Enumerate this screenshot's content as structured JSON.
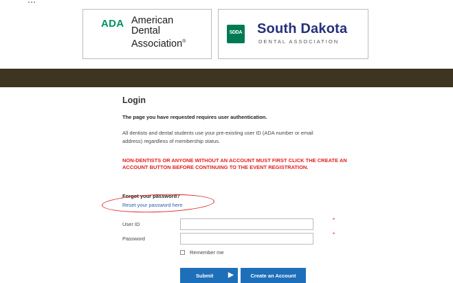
{
  "partial_header_text": "...",
  "logos": {
    "ada": {
      "mark": "ADA",
      "line1": "American",
      "line2": "Dental",
      "line3": "Association",
      "reg": "®"
    },
    "sdda": {
      "badge": "SDDA",
      "title": "South Dakota",
      "subtitle": "DENTAL ASSOCIATION"
    }
  },
  "login": {
    "title": "Login",
    "auth_message": "The page you have requested requires user authentication.",
    "info_message": "All dentists and dental students use your pre-existing user ID (ADA number or email address) regardless of membership status.",
    "warning_message": "NON-DENTISTS OR ANYONE WITHOUT AN ACCOUNT MUST FIRST CLICK THE CREATE AN ACCOUNT BUTTON BEFORE CONTINUING TO THE EVENT REGISTRATION.",
    "forgot_label": "Forgot your password?",
    "reset_link": "Reset your password here",
    "user_id_label": "User ID",
    "user_id_value": "",
    "password_label": "Password",
    "password_value": "",
    "required_marker": "*",
    "remember_label": "Remember me",
    "submit_label": "Submit",
    "submit_arrow": "▶",
    "create_account_label": "Create an Account"
  },
  "colors": {
    "brown_bar": "#3e3422",
    "warning_red": "#e0201b",
    "button_blue": "#1e6fba",
    "ada_green": "#00925b",
    "sdda_navy": "#23317a",
    "annotation_red": "#dd2222"
  }
}
